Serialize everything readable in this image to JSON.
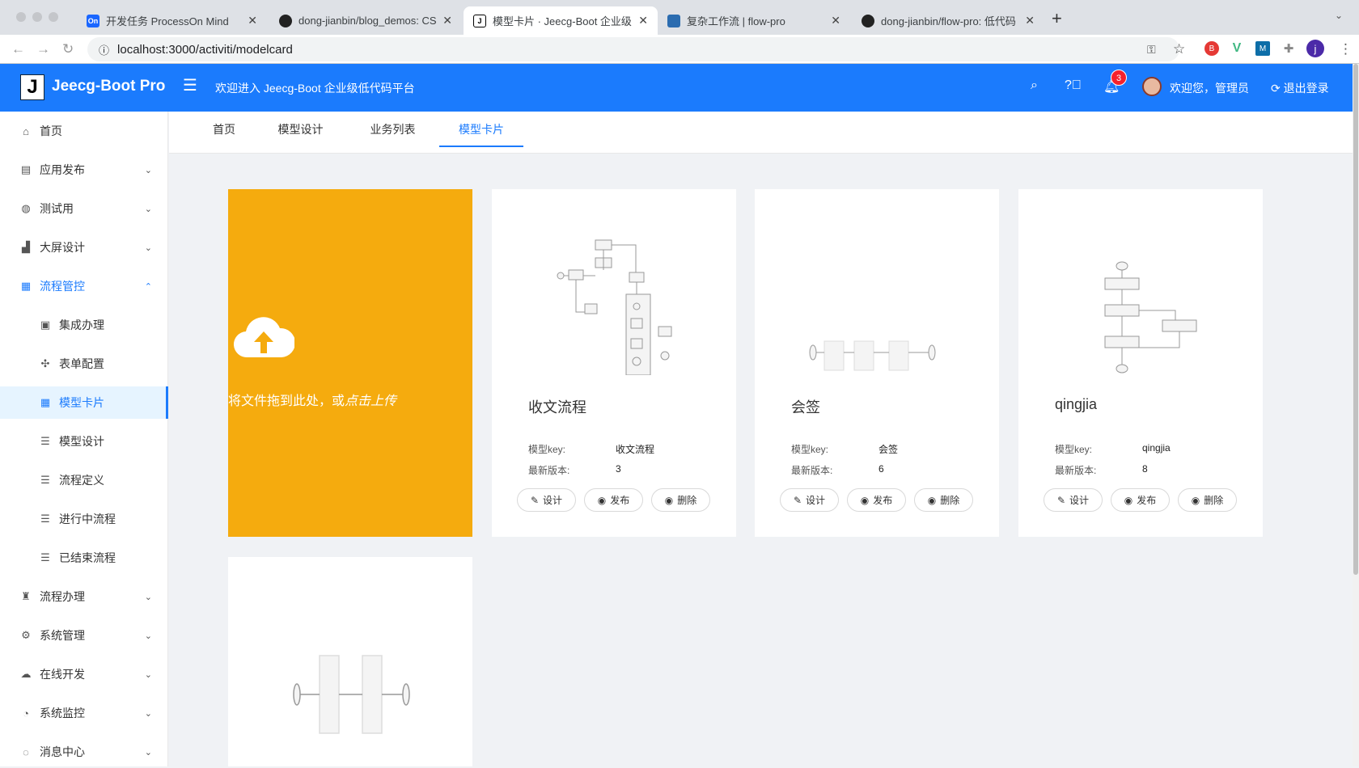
{
  "browser": {
    "tabs": [
      {
        "title": "开发任务 ProcessOn Mind",
        "icon": "On",
        "color": "#1a66ff"
      },
      {
        "title": "dong-jianbin/blog_demos: CSD",
        "icon": "github",
        "color": "#222"
      },
      {
        "title": "模型卡片 · Jeecg-Boot 企业级低",
        "icon": "J",
        "color": "#000"
      },
      {
        "title": "复杂工作流 | flow-pro",
        "icon": "flow",
        "color": "#2b6cb0"
      },
      {
        "title": "dong-jianbin/flow-pro: 低代码 全",
        "icon": "github",
        "color": "#222"
      }
    ],
    "url": "localhost:3000/activiti/modelcard",
    "profile": "j"
  },
  "header": {
    "brand": "Jeecg-Boot Pro",
    "logo": "J",
    "welcome": "欢迎进入 Jeecg-Boot 企业级低代码平台",
    "notifications": "3",
    "user": "欢迎您，管理员",
    "logout": "退出登录"
  },
  "sidebar": {
    "items": [
      {
        "label": "首页",
        "icon": "⌂"
      },
      {
        "label": "应用发布",
        "icon": "▤",
        "chev": "⌄"
      },
      {
        "label": "测试用",
        "icon": "◍",
        "chev": "⌄"
      },
      {
        "label": "大屏设计",
        "icon": "▟",
        "chev": "⌄"
      },
      {
        "label": "流程管控",
        "icon": "▦",
        "chev": "⌃"
      },
      {
        "label": "集成办理",
        "icon": "▣"
      },
      {
        "label": "表单配置",
        "icon": "✣"
      },
      {
        "label": "模型卡片",
        "icon": "▦"
      },
      {
        "label": "模型设计",
        "icon": "☰"
      },
      {
        "label": "流程定义",
        "icon": "☰"
      },
      {
        "label": "进行中流程",
        "icon": "☰"
      },
      {
        "label": "已结束流程",
        "icon": "☰"
      },
      {
        "label": "流程办理",
        "icon": "♜",
        "chev": "⌄"
      },
      {
        "label": "系统管理",
        "icon": "⚙",
        "chev": "⌄"
      },
      {
        "label": "在线开发",
        "icon": "☁",
        "chev": "⌄"
      },
      {
        "label": "系统监控",
        "icon": "◔",
        "chev": "⌄"
      },
      {
        "label": "消息中心",
        "icon": "◌",
        "chev": "⌄"
      }
    ]
  },
  "content_tabs": [
    "首页",
    "模型设计",
    "业务列表",
    "模型卡片"
  ],
  "upload": {
    "text": "将文件拖到此处，或",
    "link": "点击上传"
  },
  "labels": {
    "key": "模型key:",
    "version": "最新版本:",
    "design": "设计",
    "publish": "发布",
    "delete": "删除"
  },
  "cards": [
    {
      "name": "收文流程",
      "key": "收文流程",
      "version": "3"
    },
    {
      "name": "会签",
      "key": "会签",
      "version": "6"
    },
    {
      "name": "qingjia",
      "key": "qingjia",
      "version": "8"
    }
  ]
}
